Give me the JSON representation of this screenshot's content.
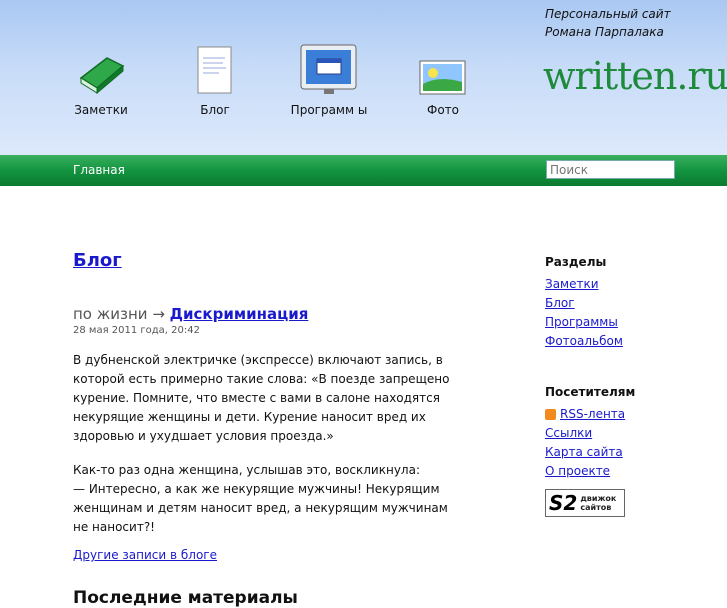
{
  "header": {
    "tagline": [
      "Персональный сайт",
      "Романа Парпалака"
    ],
    "logo": "written.ru"
  },
  "nav": {
    "items": [
      {
        "label": "Заметки",
        "icon": "book-icon"
      },
      {
        "label": "Блог",
        "icon": "document-icon"
      },
      {
        "label": "Программ ы",
        "icon": "monitor-icon"
      },
      {
        "label": "Фото",
        "icon": "photo-icon"
      }
    ],
    "home": "Главная",
    "search_placeholder": "Поиск"
  },
  "main": {
    "heading": "Блог",
    "post": {
      "category": "по жизни →",
      "title": "Дискриминация",
      "date": "28 мая 2011 года, 20:42",
      "p1": "В дубненской электричке (экспрессе) включают запись, в которой есть примерно такие слова: «В поезде запрещено курение. Помните, что вместе с вами в салоне находятся некурящие женщины и дети. Курение наносит вред их здоровью и ухудшает условия проезда.»",
      "p2_lines": [
        "Как-то раз одна женщина, услышав это, воскликнула:",
        "— Интересно, а как же некурящие мужчины! Некурящим женщинам и детям наносит вред, а некурящим мужчинам не наносит?!"
      ]
    },
    "more_link": "Другие записи в блоге",
    "latest_heading": "Последние материалы"
  },
  "sidebar": {
    "sections_title": "Разделы",
    "sections": [
      "Заметки",
      "Блог",
      "Программы",
      "Фотоальбом"
    ],
    "visitors_title": "Посетителям",
    "rss": "RSS-лента",
    "visitors": [
      "Ссылки",
      "Карта сайта",
      "О проекте"
    ],
    "engine_badge": {
      "mark": "S2",
      "text": [
        "движок",
        "сайтов"
      ]
    }
  }
}
